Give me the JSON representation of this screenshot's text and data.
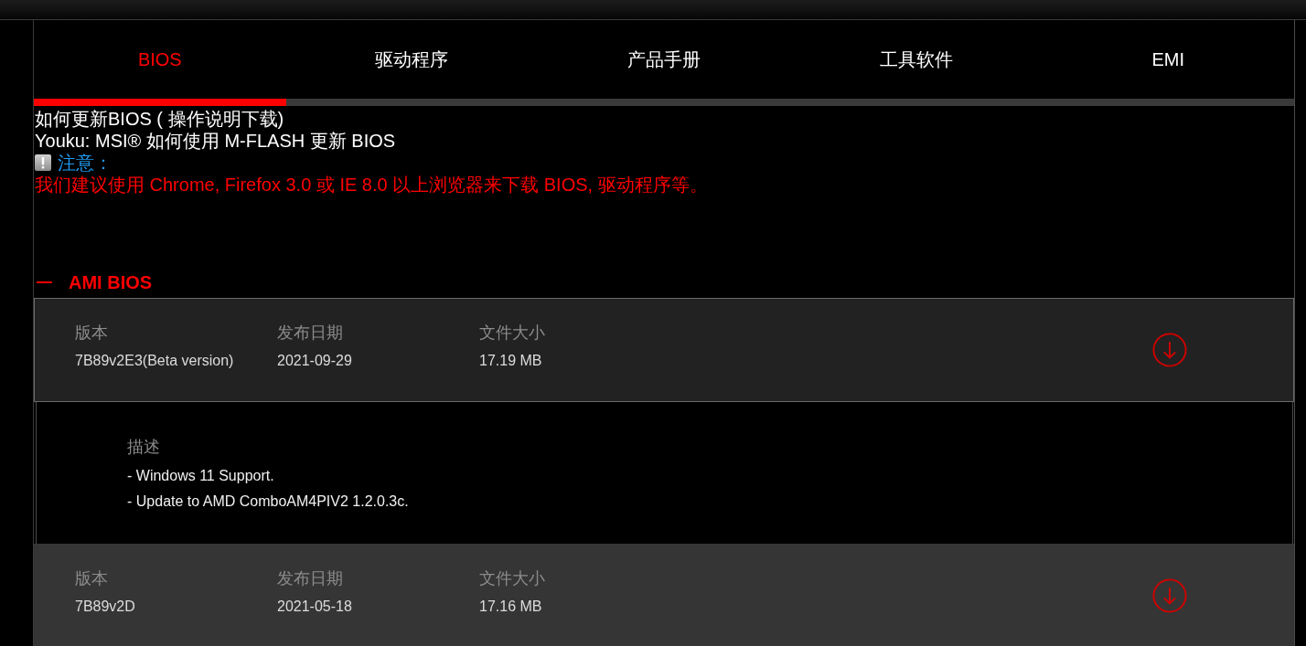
{
  "tabs": [
    {
      "label": "BIOS",
      "selected": true
    },
    {
      "label": "驱动程序",
      "selected": false
    },
    {
      "label": "产品手册",
      "selected": false
    },
    {
      "label": "工具软件",
      "selected": false
    },
    {
      "label": "EMI",
      "selected": false
    }
  ],
  "help_links": [
    "如何更新BIOS ( 操作说明下载)",
    "Youku: MSI® 如何使用 M-FLASH 更新 BIOS"
  ],
  "notice": {
    "title": "注意：",
    "text": "我们建议使用 Chrome, Firefox 3.0 或 IE 8.0 以上浏览器来下载 BIOS, 驱动程序等。"
  },
  "section": {
    "title": "AMI BIOS",
    "expanded": true,
    "entries": [
      {
        "expanded": true,
        "hovered": false,
        "fields": [
          {
            "label": "版本",
            "value": "7B89v2E3(Beta version)"
          },
          {
            "label": "发布日期",
            "value": "2021-09-29"
          },
          {
            "label": "文件大小",
            "value": "17.19 MB"
          }
        ],
        "description": {
          "label": "描述",
          "lines": [
            "- Windows 11 Support.",
            "- Update to AMD ComboAM4PIV2 1.2.0.3c."
          ]
        }
      },
      {
        "expanded": false,
        "hovered": true,
        "fields": [
          {
            "label": "版本",
            "value": "7B89v2D"
          },
          {
            "label": "发布日期",
            "value": "2021-05-18"
          },
          {
            "label": "文件大小",
            "value": "17.16 MB"
          }
        ]
      }
    ]
  }
}
